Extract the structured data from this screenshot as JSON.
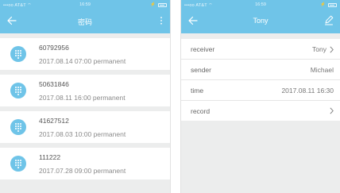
{
  "left_screen": {
    "status": {
      "carrier": "•••oo AT&T ⌔",
      "time": "16:59",
      "battery_glyph": "⚡"
    },
    "title": "密码",
    "entries": [
      {
        "password": "60792956",
        "date": "2017.08.14 07:00",
        "validity": "permanent"
      },
      {
        "password": "50631846",
        "date": "2017.08.11 16:00",
        "validity": "permanent"
      },
      {
        "password": "41627512",
        "date": "2017.08.03 10:00",
        "validity": "permanent"
      },
      {
        "password": "111222",
        "date": "2017.07.28 09:00",
        "validity": "permanent"
      }
    ]
  },
  "right_screen": {
    "status": {
      "carrier": "•••oo AT&T ⌔",
      "time": "16:59",
      "battery_glyph": "⚡"
    },
    "title": "Tony",
    "rows": [
      {
        "label": "receiver",
        "value": "Tony",
        "chevron": true
      },
      {
        "label": "sender",
        "value": "Michael",
        "chevron": false
      },
      {
        "label": "time",
        "value": "2017.08.11 16:30",
        "chevron": false
      },
      {
        "label": "record",
        "value": "",
        "chevron": true
      }
    ]
  },
  "colors": {
    "accent": "#6fc4e8",
    "background": "#eceded"
  }
}
